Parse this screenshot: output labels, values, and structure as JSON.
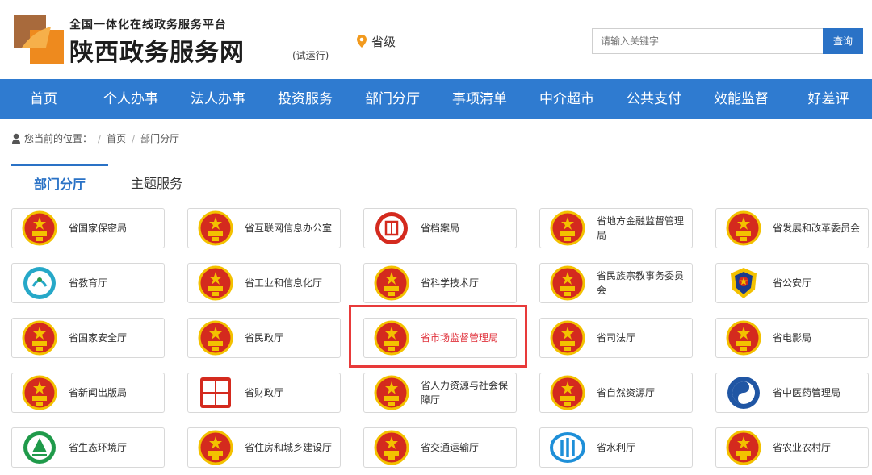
{
  "header": {
    "subtitle": "全国一体化在线政务服务平台",
    "title": "陕西政务服务网",
    "trial": "(试运行)",
    "location": "省级",
    "search_placeholder": "请输入关键字",
    "search_button": "查询"
  },
  "nav": [
    "首页",
    "个人办事",
    "法人办事",
    "投资服务",
    "部门分厅",
    "事项清单",
    "中介超市",
    "公共支付",
    "效能监督",
    "好差评"
  ],
  "breadcrumb": {
    "prefix": "您当前的位置：",
    "items": [
      "首页",
      "部门分厅"
    ]
  },
  "tabs": [
    "部门分厅",
    "主题服务"
  ],
  "departments": [
    {
      "label": "省国家保密局",
      "icon": "national-emblem"
    },
    {
      "label": "省互联网信息办公室",
      "icon": "national-emblem"
    },
    {
      "label": "省档案局",
      "icon": "archives-seal"
    },
    {
      "label": "省地方金融监督管理局",
      "icon": "national-emblem"
    },
    {
      "label": "省发展和改革委员会",
      "icon": "national-emblem"
    },
    {
      "label": "省教育厅",
      "icon": "education-emblem"
    },
    {
      "label": "省工业和信息化厅",
      "icon": "national-emblem"
    },
    {
      "label": "省科学技术厅",
      "icon": "national-emblem"
    },
    {
      "label": "省民族宗教事务委员会",
      "icon": "national-emblem"
    },
    {
      "label": "省公安厅",
      "icon": "police-emblem"
    },
    {
      "label": "省国家安全厅",
      "icon": "national-emblem"
    },
    {
      "label": "省民政厅",
      "icon": "national-emblem"
    },
    {
      "label": "省市场监督管理局",
      "icon": "national-emblem",
      "highlighted": true
    },
    {
      "label": "省司法厅",
      "icon": "national-emblem"
    },
    {
      "label": "省电影局",
      "icon": "national-emblem"
    },
    {
      "label": "省新闻出版局",
      "icon": "national-emblem"
    },
    {
      "label": "省财政厅",
      "icon": "finance-seal"
    },
    {
      "label": "省人力资源与社会保障厅",
      "icon": "national-emblem"
    },
    {
      "label": "省自然资源厅",
      "icon": "national-emblem"
    },
    {
      "label": "省中医药管理局",
      "icon": "tcm-emblem"
    },
    {
      "label": "省生态环境厅",
      "icon": "ecology-emblem"
    },
    {
      "label": "省住房和城乡建设厅",
      "icon": "national-emblem"
    },
    {
      "label": "省交通运输厅",
      "icon": "national-emblem"
    },
    {
      "label": "省水利厅",
      "icon": "water-emblem"
    },
    {
      "label": "省农业农村厅",
      "icon": "national-emblem"
    }
  ],
  "colors": {
    "nav_bg": "#2f7bd0",
    "accent": "#2a72c6",
    "highlight": "#e83a3a"
  }
}
